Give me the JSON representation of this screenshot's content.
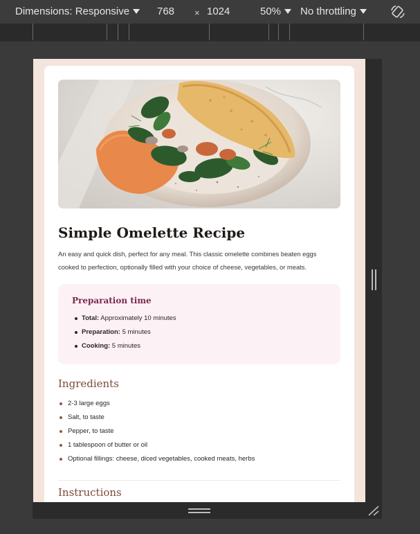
{
  "toolbar": {
    "dimensions_label": "Dimensions: Responsive",
    "width": "768",
    "times": "×",
    "height": "1024",
    "zoom": "50%",
    "throttling": "No throttling",
    "icons": [
      "chevron-down-icon",
      "rotate-icon"
    ]
  },
  "recipe": {
    "image_alt": "Omelette with spinach on a plate",
    "title": "Simple Omelette Recipe",
    "description": "An easy and quick dish, perfect for any meal. This classic omelette combines beaten eggs cooked to perfection, optionally filled with your choice of cheese, vegetables, or meats.",
    "prep": {
      "heading": "Preparation time",
      "items": [
        {
          "label": "Total:",
          "value": " Approximately 10 minutes"
        },
        {
          "label": "Preparation:",
          "value": " 5 minutes"
        },
        {
          "label": "Cooking:",
          "value": " 5 minutes"
        }
      ]
    },
    "ingredients": {
      "heading": "Ingredients",
      "items": [
        "2-3 large eggs",
        "Salt, to taste",
        "Pepper, to taste",
        "1 tablespoon of butter or oil",
        "Optional fillings: cheese, diced vegetables, cooked meats, herbs"
      ]
    },
    "instructions": {
      "heading": "Instructions"
    }
  },
  "colors": {
    "page_bg": "#f3e5dc",
    "accent_heading": "#7c4a36",
    "prep_heading": "#7a284e",
    "prep_bg": "#fcf2f6"
  }
}
